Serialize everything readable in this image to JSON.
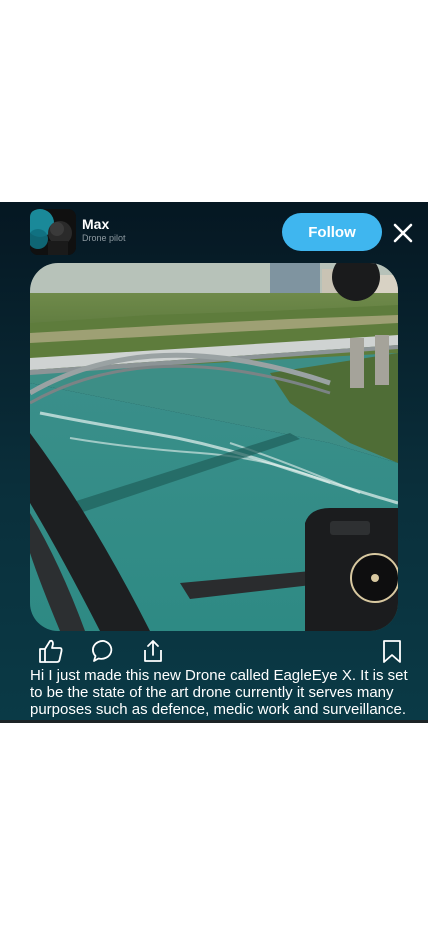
{
  "post": {
    "author": {
      "name": "Max",
      "role": "Drone pilot"
    },
    "follow_label": "Follow",
    "caption": "Hi I just made this new Drone called EagleEye X. It is set to be the state of the art drone currently it serves many purposes such as defence, medic work and surveillance."
  },
  "icons": {
    "close": "close-icon",
    "like": "thumbs-up-icon",
    "comment": "comment-icon",
    "share": "share-icon",
    "save": "bookmark-icon"
  },
  "colors": {
    "follow_button": "#3fb6ef",
    "card_background_top": "#051722",
    "card_background_bottom": "#0a3a46",
    "text": "#ffffff",
    "role_text": "#8e9aa1"
  }
}
